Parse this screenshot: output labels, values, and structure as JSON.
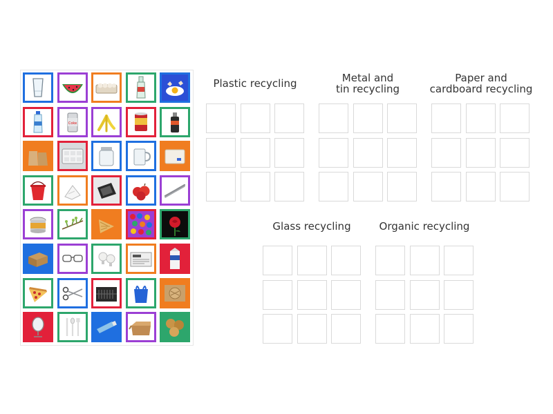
{
  "colors": {
    "blue": "#1f6fe0",
    "red": "#e2213a",
    "orange": "#f07d20",
    "green": "#2da66c",
    "purple": "#9b3fd4",
    "slot_border": "#d9d9d9"
  },
  "tiles": [
    {
      "name": "glass-tumbler",
      "color": "blue",
      "icon": "glass-icon"
    },
    {
      "name": "watermelon",
      "color": "purple",
      "icon": "watermelon-icon"
    },
    {
      "name": "egg-carton",
      "color": "orange",
      "icon": "egg-carton-icon"
    },
    {
      "name": "glass-bottle",
      "color": "green",
      "icon": "bottle-icon"
    },
    {
      "name": "broken-egg",
      "color": "blue",
      "icon": "broken-egg-icon"
    },
    {
      "name": "plastic-water-bottle",
      "color": "red",
      "icon": "water-bottle-icon"
    },
    {
      "name": "soda-can",
      "color": "purple",
      "icon": "can-icon",
      "label": "Coke"
    },
    {
      "name": "banana-peel",
      "color": "purple",
      "icon": "banana-peel-icon"
    },
    {
      "name": "food-tin",
      "color": "red",
      "icon": "tin-icon"
    },
    {
      "name": "spray-can",
      "color": "green",
      "icon": "spray-can-icon"
    },
    {
      "name": "paper-bags",
      "color": "orange",
      "icon": "paper-bag-icon"
    },
    {
      "name": "plastic-tray",
      "color": "red",
      "icon": "tray-icon"
    },
    {
      "name": "glass-jar",
      "color": "blue",
      "icon": "jar-icon"
    },
    {
      "name": "glass-mug",
      "color": "blue",
      "icon": "mug-icon"
    },
    {
      "name": "plastic-container",
      "color": "orange",
      "icon": "container-icon"
    },
    {
      "name": "plastic-bucket",
      "color": "green",
      "icon": "bucket-icon"
    },
    {
      "name": "tissue",
      "color": "orange",
      "icon": "tissue-icon"
    },
    {
      "name": "foil-packet",
      "color": "red",
      "icon": "foil-icon"
    },
    {
      "name": "apples",
      "color": "blue",
      "icon": "apple-icon"
    },
    {
      "name": "tweezers",
      "color": "purple",
      "icon": "tweezers-icon"
    },
    {
      "name": "open-tin-can",
      "color": "purple",
      "icon": "open-can-icon"
    },
    {
      "name": "twig",
      "color": "green",
      "icon": "twig-icon"
    },
    {
      "name": "ice-cream-cone",
      "color": "orange",
      "icon": "cone-icon"
    },
    {
      "name": "bottle-caps",
      "color": "red",
      "icon": "caps-icon"
    },
    {
      "name": "rose",
      "color": "green",
      "icon": "rose-icon"
    },
    {
      "name": "cardboard-box",
      "color": "blue",
      "icon": "box-icon"
    },
    {
      "name": "eyeglasses",
      "color": "purple",
      "icon": "glasses-icon"
    },
    {
      "name": "light-bulbs",
      "color": "green",
      "icon": "bulb-icon"
    },
    {
      "name": "newspapers",
      "color": "orange",
      "icon": "newspaper-icon"
    },
    {
      "name": "milk-carton",
      "color": "red",
      "icon": "carton-icon"
    },
    {
      "name": "pizza-slice",
      "color": "green",
      "icon": "pizza-icon"
    },
    {
      "name": "scissors",
      "color": "blue",
      "icon": "scissors-icon"
    },
    {
      "name": "plastic-crate",
      "color": "red",
      "icon": "crate-icon"
    },
    {
      "name": "plastic-bag",
      "color": "green",
      "icon": "bag-icon"
    },
    {
      "name": "pizza-box",
      "color": "orange",
      "icon": "pizza-box-icon"
    },
    {
      "name": "mirror",
      "color": "red",
      "icon": "mirror-icon"
    },
    {
      "name": "plastic-cutlery",
      "color": "green",
      "icon": "cutlery-icon"
    },
    {
      "name": "toothpaste-tube",
      "color": "blue",
      "icon": "tube-icon"
    },
    {
      "name": "open-box",
      "color": "purple",
      "icon": "open-box-icon"
    },
    {
      "name": "bread-rolls",
      "color": "green",
      "icon": "bread-icon"
    }
  ],
  "groups": [
    {
      "key": "plastic",
      "title": "Plastic recycling"
    },
    {
      "key": "metal",
      "title": "Metal and\ntin recycling"
    },
    {
      "key": "paper",
      "title": "Paper and\ncardboard recycling"
    },
    {
      "key": "glass",
      "title": "Glass recycling"
    },
    {
      "key": "organic",
      "title": "Organic recycling"
    }
  ]
}
